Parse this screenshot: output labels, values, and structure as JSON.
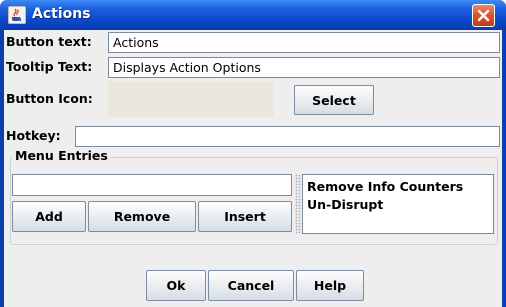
{
  "window": {
    "title": "Actions",
    "titlebar_color": "#1d5fe0",
    "close_color": "#d8532d"
  },
  "form": {
    "button_text_label": "Button text:",
    "button_text_value": "Actions",
    "tooltip_label": "Tooltip Text:",
    "tooltip_value": "Displays Action Options",
    "icon_label": "Button Icon:",
    "select_label": "Select",
    "hotkey_label": "Hotkey:",
    "hotkey_value": ""
  },
  "menu_entries": {
    "title": "Menu Entries",
    "input_value": "",
    "add_label": "Add",
    "remove_label": "Remove",
    "insert_label": "Insert",
    "items": [
      "Remove Info Counters",
      "Un-Disrupt"
    ]
  },
  "footer": {
    "ok_label": "Ok",
    "cancel_label": "Cancel",
    "help_label": "Help"
  }
}
